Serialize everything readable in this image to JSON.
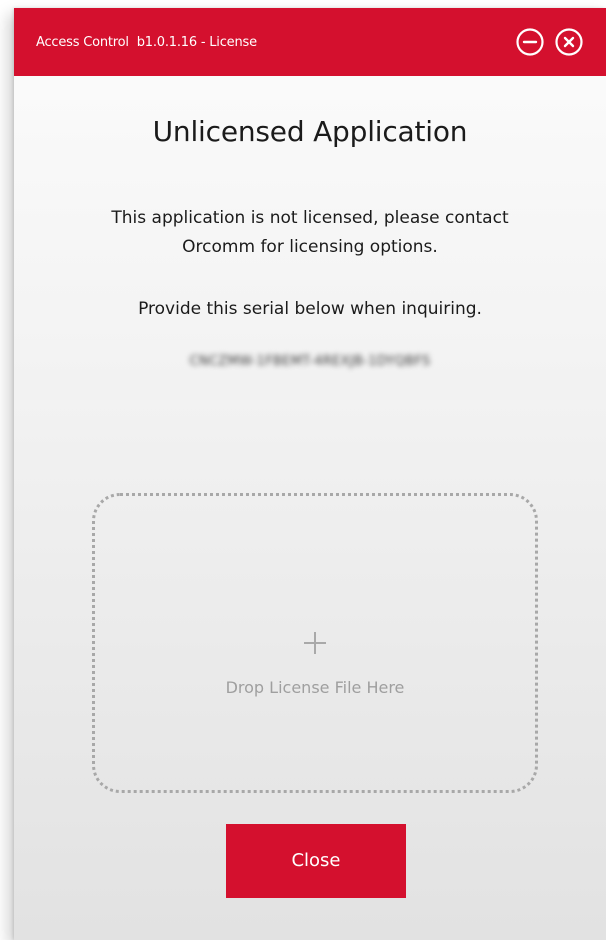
{
  "window": {
    "title": "Access Control  b1.0.1.16 - License",
    "minimize_icon": "minus-circle-icon",
    "close_icon": "x-circle-icon",
    "accent_color": "#d4102e"
  },
  "content": {
    "heading": "Unlicensed Application",
    "message_lines": [
      "This application is not licensed, please contact",
      "Orcomm for licensing options."
    ],
    "instruction": "Provide this serial below when inquiring.",
    "serial": "CNCZMW-1FBEMT-4REXJB-1DYQBFS"
  },
  "dropzone": {
    "icon": "plus-icon",
    "label": "Drop License File Here"
  },
  "footer": {
    "close_label": "Close"
  }
}
